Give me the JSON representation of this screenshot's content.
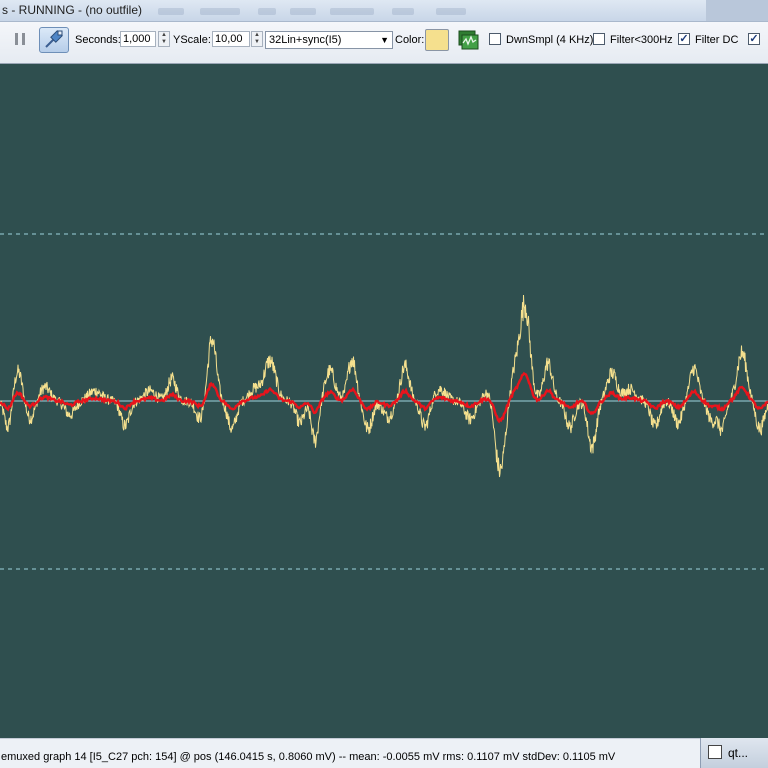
{
  "window": {
    "title": "s - RUNNING - (no outfile)"
  },
  "toolbar": {
    "pause_icon": "pause-icon",
    "pin_icon": "pin-icon",
    "seconds_label": "Seconds:",
    "seconds_value": "1,000",
    "yscale_label": "YScale:",
    "yscale_value": "10,00",
    "channel_select": "32Lin+sync(I5)",
    "color_label": "Color:",
    "color_value": "#f5e08e",
    "graph_icon": "graph-settings-icon",
    "options": [
      {
        "label": "DwnSmpl (4 KHz)",
        "checked": false
      },
      {
        "label": "Filter<300Hz",
        "checked": false
      },
      {
        "label": "Filter DC",
        "checked": true
      },
      {
        "label": "",
        "checked": true
      }
    ]
  },
  "plot": {
    "background": "#2f4f4f",
    "raw_trace_color": "#f5e08e",
    "filtered_trace_color": "#e8141c",
    "baseline_color": "#9ed3de",
    "gridline_color": "#9ed3de"
  },
  "status": {
    "text": "emuxed graph 14 [I5_C27 pch: 154] @ pos (146.0415 s, 0.8060 mV) -- mean: -0.0055 mV rms: 0.1107 mV stdDev: 0.1105 mV"
  },
  "taskbar": {
    "label": "qt..."
  }
}
